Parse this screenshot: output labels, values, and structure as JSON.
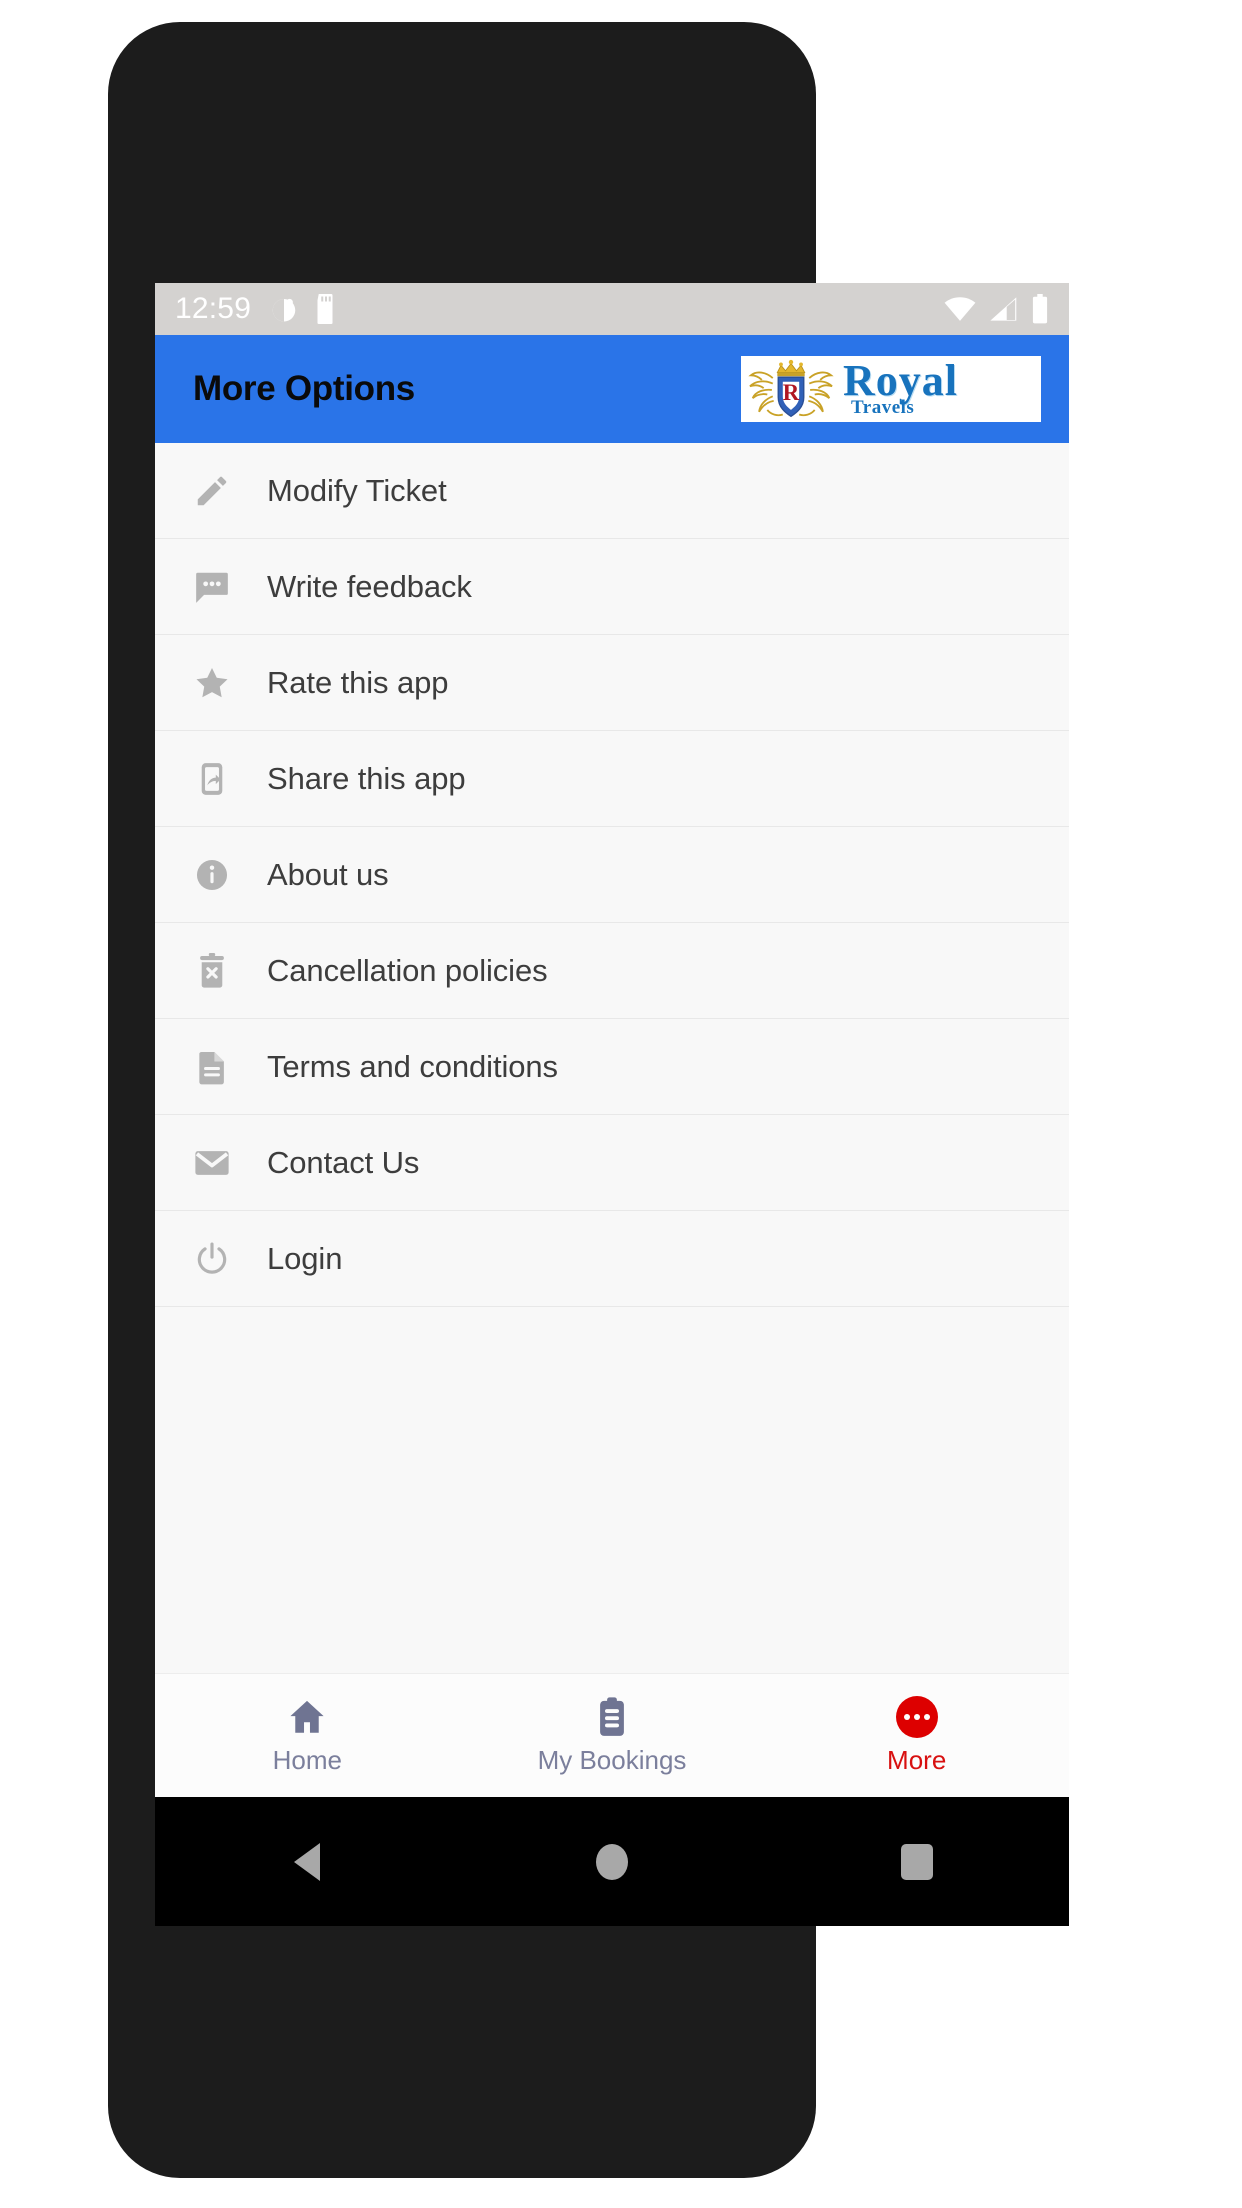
{
  "status_bar": {
    "time": "12:59",
    "left_icons": [
      "alarm-icon",
      "sd-card-icon"
    ],
    "right_icons": [
      "wifi-icon",
      "cellular-signal-icon",
      "battery-icon"
    ]
  },
  "appbar": {
    "title": "More Options",
    "background_color": "#2a74e8",
    "title_color": "#0a0a0a",
    "logo": {
      "brand": "Royal",
      "subtitle": "Travels",
      "crest_letter": "R",
      "brand_color": "#1873bd",
      "crest_gold": "#c8a020",
      "crest_shield_blue": "#2a5fb4",
      "crest_letter_color": "#b01722"
    }
  },
  "menu": {
    "items": [
      {
        "label": "Modify Ticket",
        "icon": "pencil-icon"
      },
      {
        "label": "Write feedback",
        "icon": "chat-bubble-icon"
      },
      {
        "label": "Rate this app",
        "icon": "star-icon"
      },
      {
        "label": "Share this app",
        "icon": "share-phone-icon"
      },
      {
        "label": "About us",
        "icon": "info-circle-icon"
      },
      {
        "label": "Cancellation policies",
        "icon": "trash-x-icon"
      },
      {
        "label": "Terms and conditions",
        "icon": "document-icon"
      },
      {
        "label": "Contact Us",
        "icon": "envelope-icon"
      },
      {
        "label": "Login",
        "icon": "power-icon"
      }
    ],
    "icon_color": "#b3b3b3",
    "text_color": "#3d3d3d",
    "row_background": "#f8f8f8"
  },
  "bottom_nav": {
    "items": [
      {
        "label": "Home",
        "icon": "home-icon",
        "active": false
      },
      {
        "label": "My Bookings",
        "icon": "clipboard-icon",
        "active": false
      },
      {
        "label": "More",
        "icon": "more-dots-icon",
        "active": true
      }
    ],
    "inactive_color": "#7b7f9c",
    "active_color": "#d81010"
  },
  "android_nav": {
    "buttons": [
      "back-icon",
      "home-icon",
      "recents-icon"
    ],
    "icon_color": "#a8a8a8",
    "background_color": "#000000"
  }
}
